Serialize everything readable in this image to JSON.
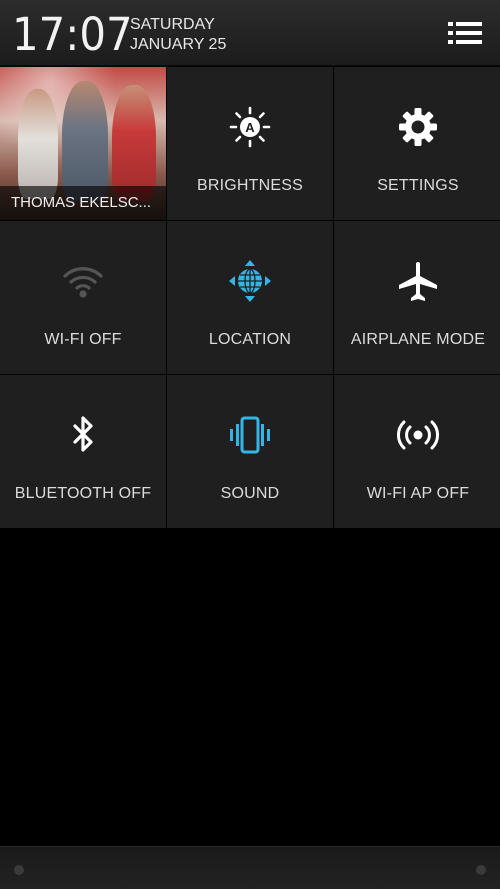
{
  "header": {
    "time": "17:07",
    "day": "SATURDAY",
    "date": "JANUARY 25"
  },
  "tiles": [
    {
      "label": "THOMAS EKELSC...",
      "icon": "contact-photo",
      "kind": "contact"
    },
    {
      "label": "BRIGHTNESS",
      "icon": "brightness-auto-icon",
      "color": "#ffffff"
    },
    {
      "label": "SETTINGS",
      "icon": "gear-icon",
      "color": "#ffffff"
    },
    {
      "label": "WI-FI OFF",
      "icon": "wifi-icon",
      "color": "#555555"
    },
    {
      "label": "LOCATION",
      "icon": "location-globe-icon",
      "color": "#33b5e5"
    },
    {
      "label": "AIRPLANE MODE",
      "icon": "airplane-icon",
      "color": "#ffffff"
    },
    {
      "label": "BLUETOOTH OFF",
      "icon": "bluetooth-icon",
      "color": "#ffffff"
    },
    {
      "label": "SOUND",
      "icon": "vibrate-icon",
      "color": "#33b5e5"
    },
    {
      "label": "WI-FI AP OFF",
      "icon": "hotspot-icon",
      "color": "#ffffff"
    }
  ],
  "colors": {
    "accent": "#33b5e5",
    "tile_bg": "#1f1f1f",
    "background": "#000000"
  }
}
